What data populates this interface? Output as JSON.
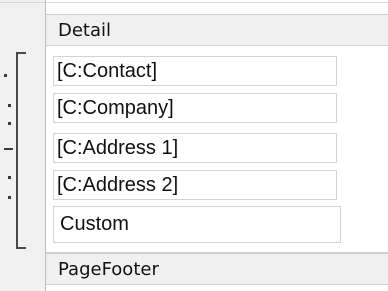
{
  "sections": {
    "detail_label": "Detail",
    "footer_label": "PageFooter"
  },
  "fields": [
    {
      "label": "[C:Contact]"
    },
    {
      "label": "[C:Company]"
    },
    {
      "label": "[C:Address 1]"
    },
    {
      "label": "[C:Address 2]"
    },
    {
      "label": "Custom"
    }
  ]
}
